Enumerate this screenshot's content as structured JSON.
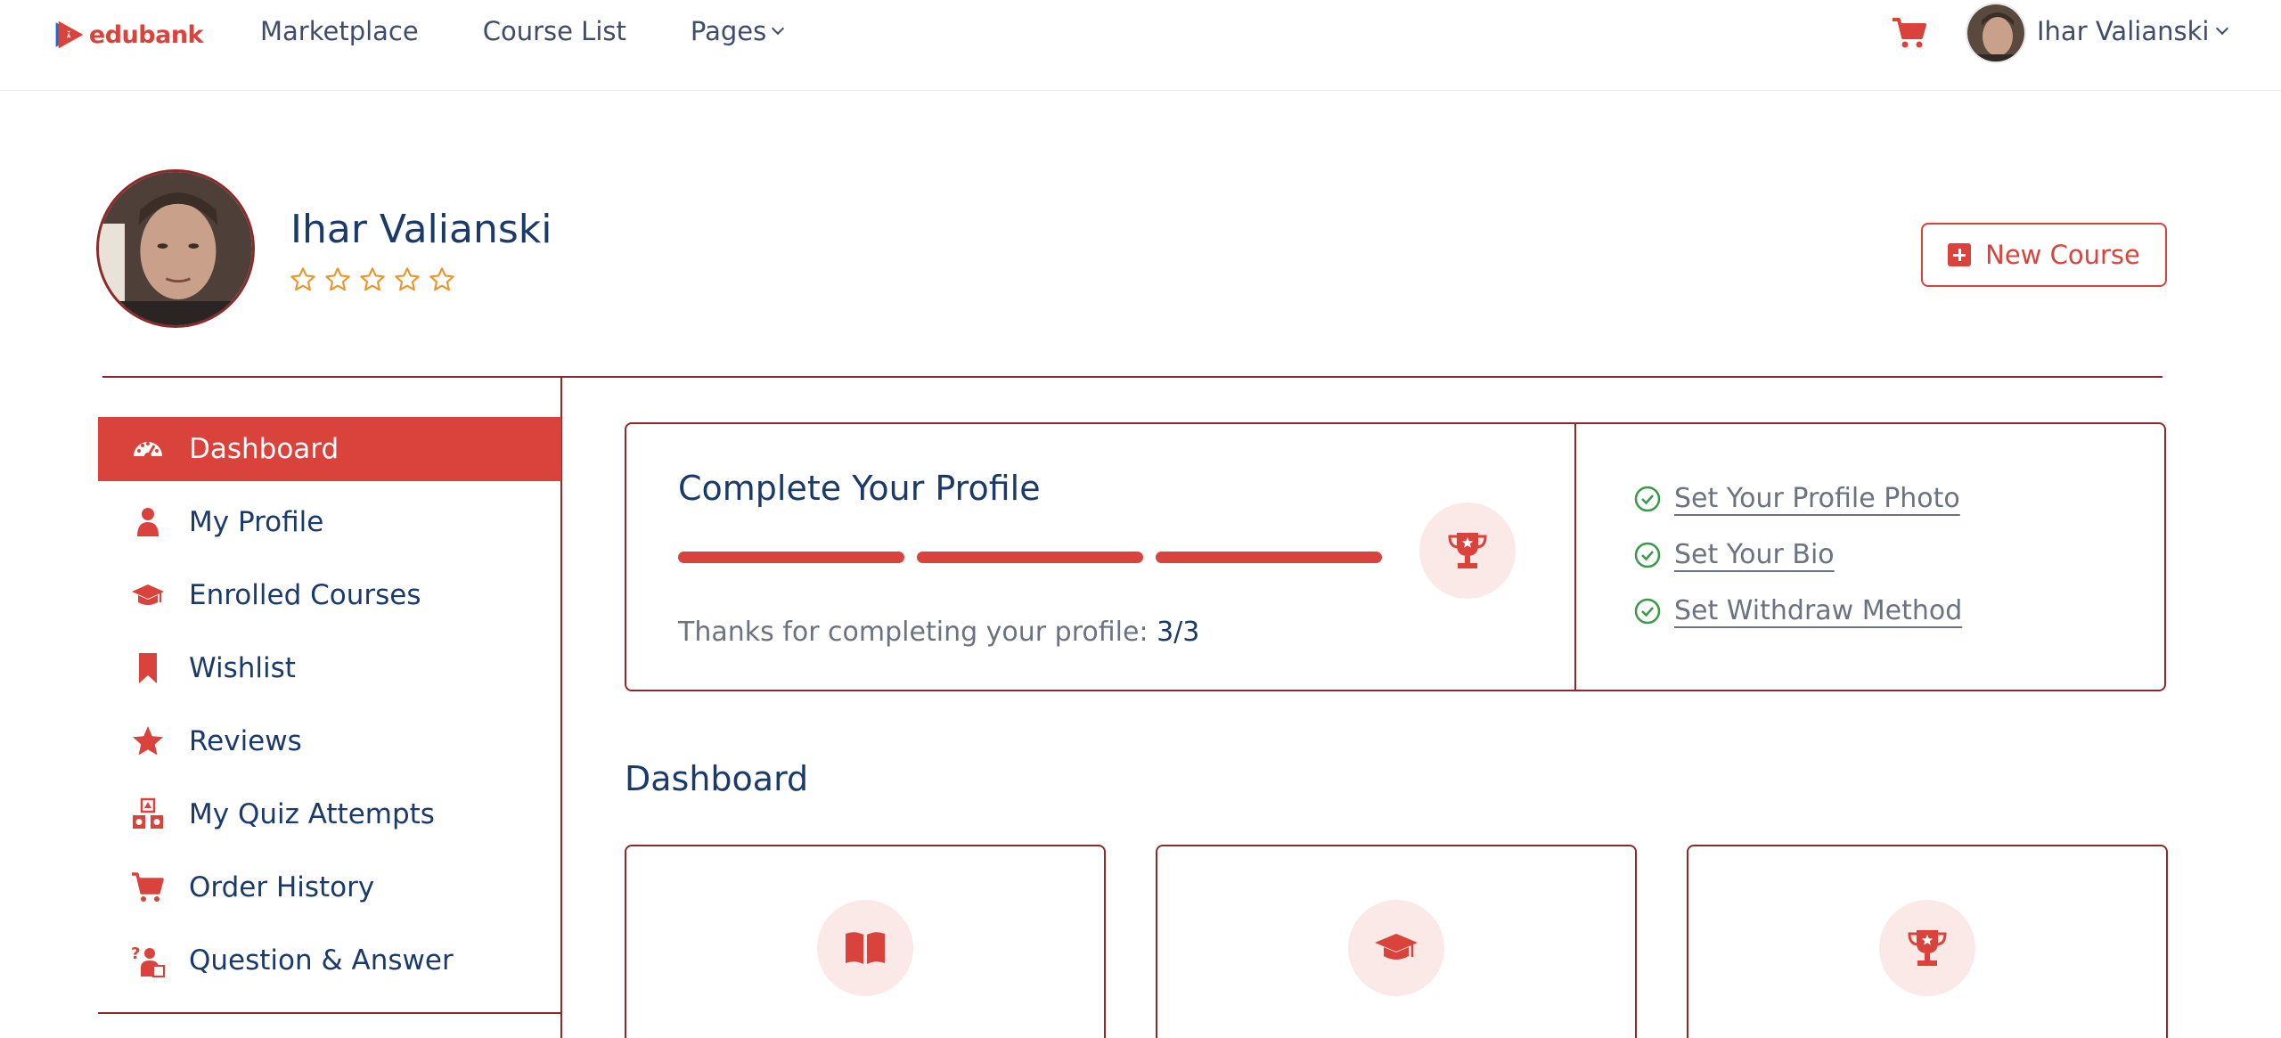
{
  "brand": {
    "name": "edubank",
    "accent": "#d9433b",
    "navy": "#1a3a6b"
  },
  "nav": {
    "items": [
      "Marketplace",
      "Course List",
      "Pages"
    ]
  },
  "user": {
    "name": "Ihar Valianski"
  },
  "profile": {
    "name": "Ihar Valianski",
    "rating": 0,
    "rating_max": 5
  },
  "actions": {
    "new_course": "New Course"
  },
  "sidebar": {
    "items": [
      {
        "label": "Dashboard",
        "icon": "dashboard-gauge-icon",
        "active": true
      },
      {
        "label": "My Profile",
        "icon": "user-icon"
      },
      {
        "label": "Enrolled Courses",
        "icon": "graduation-cap-icon"
      },
      {
        "label": "Wishlist",
        "icon": "bookmark-icon"
      },
      {
        "label": "Reviews",
        "icon": "star-icon"
      },
      {
        "label": "My Quiz Attempts",
        "icon": "shapes-icon"
      },
      {
        "label": "Order History",
        "icon": "cart-icon"
      },
      {
        "label": "Question & Answer",
        "icon": "question-person-icon"
      }
    ]
  },
  "complete_profile": {
    "title": "Complete Your Profile",
    "progress_steps_done": 3,
    "progress_steps_total": 3,
    "status_prefix": "Thanks for completing your profile: ",
    "status_value": "3/3",
    "checklist": [
      "Set Your Profile Photo",
      "Set Your Bio",
      "Set Withdraw Method"
    ]
  },
  "dashboard": {
    "title": "Dashboard",
    "cards": [
      {
        "icon": "book-open-icon"
      },
      {
        "icon": "graduation-cap-icon"
      },
      {
        "icon": "trophy-icon"
      }
    ]
  }
}
